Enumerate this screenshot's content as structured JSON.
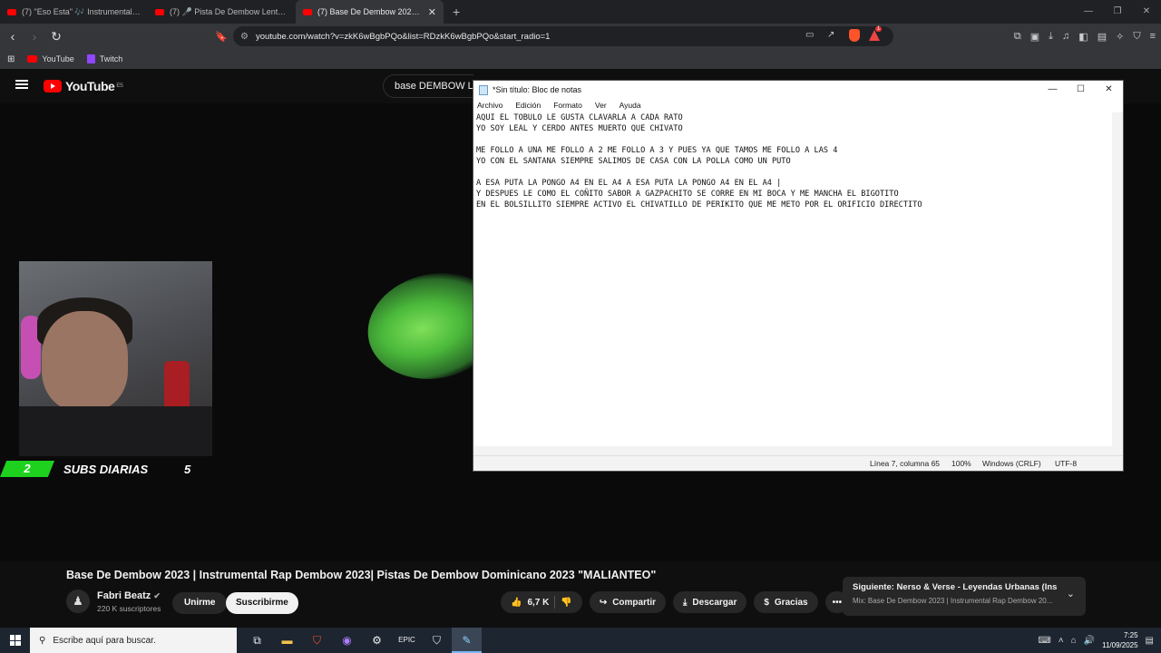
{
  "browser": {
    "tabs": [
      {
        "label": "(7) \"Eso Esta\" 🎶 Instrumental de T",
        "active": false
      },
      {
        "label": "(7) 🎤 Pista De Dembow Lento Com",
        "active": false
      },
      {
        "label": "(7) Base De Dembow 2023 | In",
        "active": true
      }
    ],
    "new_tab": "+",
    "url": "youtube.com/watch?v=zkK6wBgbPQo&list=RDzkK6wBgbPQo&start_radio=1",
    "bookmarks": [
      "YouTube",
      "Twitch"
    ],
    "brave_badge": "1"
  },
  "youtube": {
    "logo_text": "YouTube",
    "logo_region": "ES",
    "search_value": "base DEMBOW LE"
  },
  "overlay": {
    "subs_left": "2",
    "subs_text": "SUBS DIARIAS",
    "subs_right": "5"
  },
  "video": {
    "title": "Base De Dembow 2023 | Instrumental Rap Dembow 2023| Pistas De Dembow Dominicano 2023 \"MALIANTEO\"",
    "channel_name": "Fabri Beatz",
    "channel_subs": "220 K suscriptores",
    "join_label": "Unirme",
    "subscribe_label": "Suscribirme",
    "likes": "6,7 K",
    "share_label": "Compartir",
    "download_label": "Descargar",
    "thanks_label": "Gracias",
    "next_title": "Siguiente: Nerso & Verse - Leyendas Urbanas (Instr...",
    "next_sub": "Mix: Base De Dembow 2023 | Instrumental Rap Dembow 20..."
  },
  "notepad": {
    "title": "*Sin título: Bloc de notas",
    "menu": [
      "Archivo",
      "Edición",
      "Formato",
      "Ver",
      "Ayuda"
    ],
    "text": "AQUI EL TOBULO LE GUSTA CLAVARLA A CADA RATO\nYO SOY LEAL Y CERDO ANTES MUERTO QUE CHIVATO\n\nME FOLLO A UNA ME FOLLO A 2 ME FOLLO A 3 Y PUES YA QUE TAMOS ME FOLLO A LAS 4\nYO CON EL SANTANA SIEMPRE SALIMOS DE CASA CON LA POLLA COMO UN PUTO\n\nA ESA PUTA LA PONGO A4 EN EL A4 A ESA PUTA LA PONGO A4 EN EL A4 |\nY DESPUES LE COMO EL COÑITO SABOR A GAZPACHITO SE CORRE EN MI BOCA Y ME MANCHA EL BIGOTITO\nEN EL BOLSILLITO SIEMPRE ACTIVO EL CHIVATILLO DE PERIKITO QUE ME METO POR EL ORIFICIO DIRECTITO",
    "status_position": "Línea 7, columna 65",
    "status_zoom": "100%",
    "status_eol": "Windows (CRLF)",
    "status_encoding": "UTF-8"
  },
  "taskbar": {
    "search_placeholder": "Escribe aquí para buscar.",
    "time": "7:25",
    "date": "11/09/2025"
  },
  "colors": {
    "yt_red": "#ff0000",
    "subs_green": "#1ed11e",
    "taskbar_bg": "#1c2530"
  }
}
